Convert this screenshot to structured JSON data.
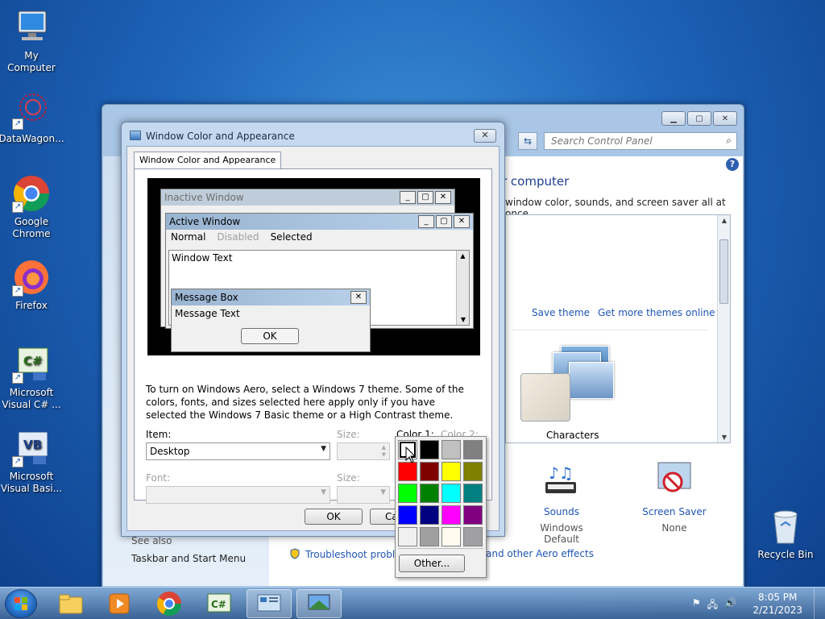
{
  "desktop": {
    "icons": [
      {
        "label": "My Computer"
      },
      {
        "label": "DataWagon..."
      },
      {
        "label": "Google\nChrome"
      },
      {
        "label": "Firefox"
      },
      {
        "label": "Microsoft\nVisual C# ..."
      },
      {
        "label": "Microsoft\nVisual Basi..."
      }
    ],
    "recycle_bin": "Recycle Bin"
  },
  "control_panel": {
    "search_placeholder": "Search Control Panel",
    "title_partial": "r computer",
    "subtitle_partial": "window color, sounds, and screen saver all at once.",
    "save_theme": "Save theme",
    "more_themes": "Get more themes online",
    "theme_name": "Characters",
    "sounds_label": "Sounds",
    "sounds_value": "Windows Default",
    "saver_label": "Screen Saver",
    "saver_value": "None",
    "see_also": "See also",
    "taskbar_link": "Taskbar and Start Menu",
    "troubleshoot": "Troubleshoot probler",
    "aero": "and other Aero effects"
  },
  "dialog": {
    "title": "Window Color and Appearance",
    "tab": "Window Color and Appearance",
    "preview": {
      "inactive_title": "Inactive Window",
      "active_title": "Active Window",
      "menu_normal": "Normal",
      "menu_disabled": "Disabled",
      "menu_selected": "Selected",
      "window_text": "Window Text",
      "msgbox_title": "Message Box",
      "msgbox_text": "Message Text",
      "msgbox_ok": "OK"
    },
    "description": "To turn on Windows Aero, select a Windows 7 theme.  Some of the colors, fonts, and sizes selected here apply only if you have selected the Windows 7 Basic theme or a High Contrast theme.",
    "item_label": "Item:",
    "item_value": "Desktop",
    "size_label": "Size:",
    "color1_label": "Color 1:",
    "color2_label": "Color 2:",
    "font_label": "Font:",
    "font_size_label": "Size:",
    "ok": "OK",
    "cancel": "Ca"
  },
  "color_popup": {
    "swatches": [
      "#ffffff",
      "#000000",
      "#c0c0c0",
      "#808080",
      "#ff0000",
      "#800000",
      "#ffff00",
      "#808000",
      "#00ff00",
      "#008000",
      "#00ffff",
      "#008080",
      "#0000ff",
      "#000080",
      "#ff00ff",
      "#800080",
      "#f0f0f0",
      "#a0a0a0",
      "#fffbf0",
      "#a0a0a4"
    ],
    "selected_index": 0,
    "other": "Other..."
  },
  "taskbar": {
    "time": "8:05 PM",
    "date": "2/21/2023"
  }
}
